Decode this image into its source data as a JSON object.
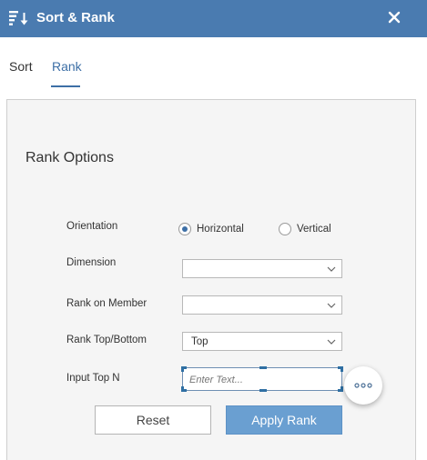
{
  "header": {
    "title": "Sort & Rank",
    "icon": "sort-descending-icon",
    "close_icon": "close-icon",
    "background": "#4a7bb0"
  },
  "tabs": [
    {
      "label": "Sort",
      "active": false
    },
    {
      "label": "Rank",
      "active": true
    }
  ],
  "rank_options": {
    "title": "Rank Options",
    "orientation": {
      "label": "Orientation",
      "options": [
        {
          "label": "Horizontal",
          "checked": true
        },
        {
          "label": "Vertical",
          "checked": false
        }
      ]
    },
    "dimension": {
      "label": "Dimension",
      "value": ""
    },
    "rank_on_member": {
      "label": "Rank on Member",
      "value": ""
    },
    "rank_top_bottom": {
      "label": "Rank Top/Bottom",
      "value": "Top"
    },
    "input_top_n": {
      "label": "Input Top N",
      "placeholder": "Enter Text...",
      "value": ""
    },
    "more_icon": "ellipsis-icon"
  },
  "buttons": {
    "reset": "Reset",
    "apply": "Apply Rank",
    "apply_color": "#6a9fd1"
  }
}
